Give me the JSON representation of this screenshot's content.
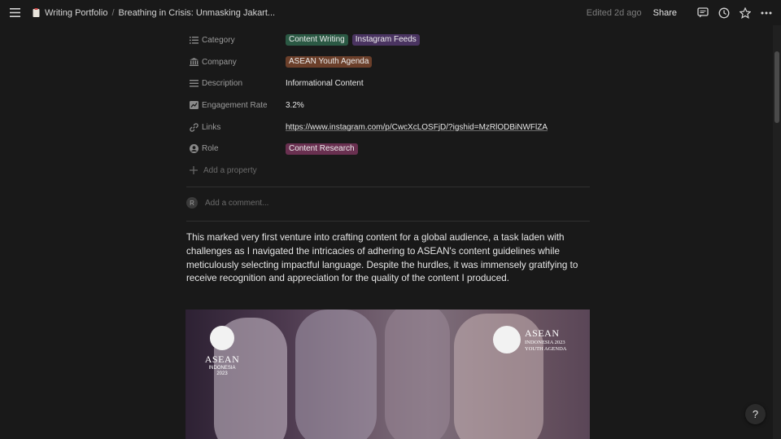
{
  "topbar": {
    "breadcrumb_root": "Writing Portfolio",
    "separator": "/",
    "page_title": "Breathing in Crisis: Unmasking Jakart...",
    "edited": "Edited 2d ago",
    "share_label": "Share"
  },
  "properties": [
    {
      "name": "Category",
      "icon": "list-icon",
      "type": "tags",
      "tags": [
        {
          "label": "Content Writing",
          "color": "#2b5944"
        },
        {
          "label": "Instagram Feeds",
          "color": "#4a3461"
        }
      ]
    },
    {
      "name": "Company",
      "icon": "bank-icon",
      "type": "tags",
      "tags": [
        {
          "label": "ASEAN Youth Agenda",
          "color": "#6b3f2a"
        }
      ]
    },
    {
      "name": "Description",
      "icon": "text-lines-icon",
      "type": "text",
      "value": "Informational Content"
    },
    {
      "name": "Engagement Rate",
      "icon": "chart-icon",
      "type": "text",
      "value": "3.2%"
    },
    {
      "name": "Links",
      "icon": "link-icon",
      "type": "link",
      "value": "https://www.instagram.com/p/CwcXcLOSFjD/?igshid=MzRlODBiNWFlZA"
    },
    {
      "name": "Role",
      "icon": "person-icon",
      "type": "tags",
      "tags": [
        {
          "label": "Content Research",
          "color": "#693050"
        }
      ]
    }
  ],
  "add_property": "Add a property",
  "comment": {
    "avatar": "R",
    "placeholder": "Add a comment..."
  },
  "body": "This marked very first venture into crafting content for a global audience, a task laden with challenges as I navigated the intricacies of adhering to ASEAN's content guidelines while meticulously selecting impactful language. Despite the hurdles, it was immensely gratifying to receive recognition and appreciation for the quality of the content I produced.",
  "image": {
    "left_logo": {
      "title": "ASEAN",
      "line1": "INDONESIA",
      "line2": "2023"
    },
    "right_logo": {
      "title": "ASEAN",
      "line1": "INDONESIA 2023",
      "line2": "YOUTH AGENDA"
    }
  },
  "help_label": "?"
}
